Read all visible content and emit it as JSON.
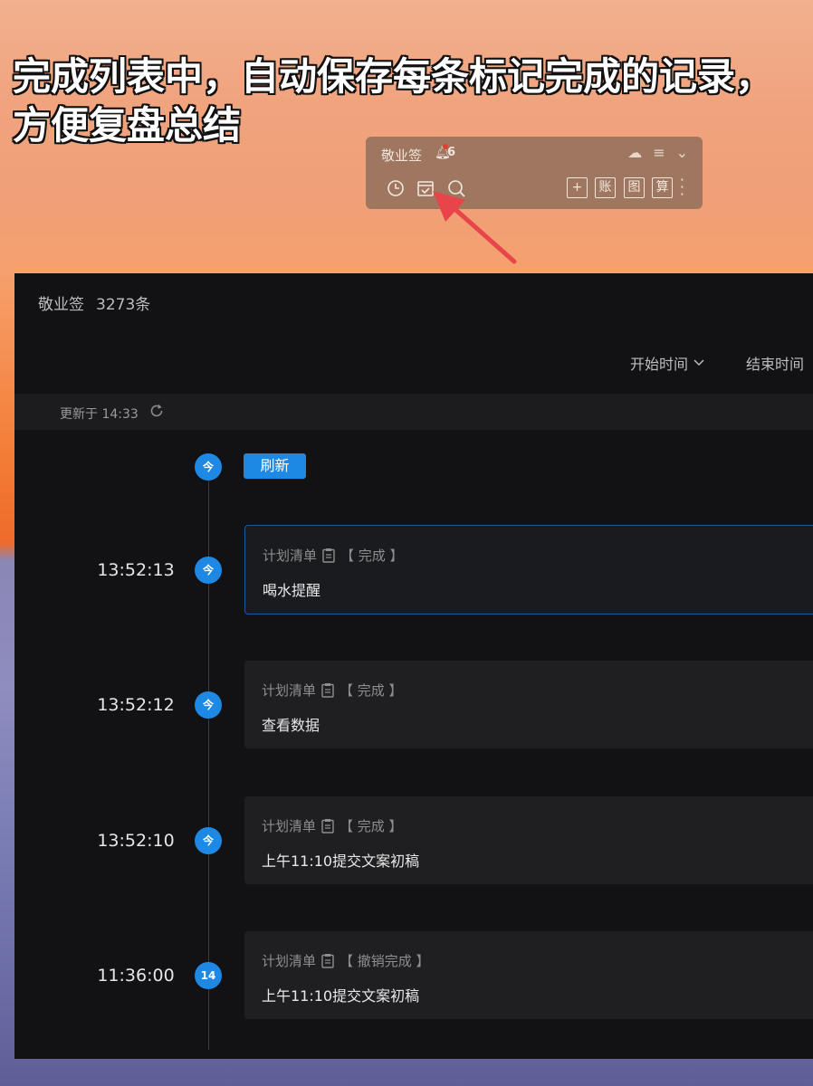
{
  "caption": {
    "line1": "完成列表中，自动保存每条标记完成的记录，",
    "line2": "方便复盘总结"
  },
  "widget": {
    "title": "敬业签",
    "reminder_count": "6",
    "buttons": [
      "+",
      "账",
      "图",
      "算"
    ],
    "icons": [
      "clock-icon",
      "done-list-icon",
      "search-icon",
      "cloud-icon",
      "menu-icon",
      "chevron-down-icon"
    ]
  },
  "window": {
    "title": "敬业签",
    "count": "3273条",
    "filter_start": "开始时间",
    "filter_end": "结束时间",
    "updated_text": "更新于 14:33",
    "refresh_button": "刷新",
    "today_marker": "今",
    "records": [
      {
        "time": "13:52:13",
        "node": "今",
        "list": "计划清单",
        "status": "【 完成 】",
        "content": "喝水提醒"
      },
      {
        "time": "13:52:12",
        "node": "今",
        "list": "计划清单",
        "status": "【 完成 】",
        "content": "查看数据"
      },
      {
        "time": "13:52:10",
        "node": "今",
        "list": "计划清单",
        "status": "【 完成 】",
        "content": "上午11:10提交文案初稿"
      },
      {
        "time": "11:36:00",
        "node": "14",
        "list": "计划清单",
        "status": "【 撤销完成 】",
        "content": "上午11:10提交文案初稿"
      }
    ]
  },
  "colors": {
    "accent": "#1e88e5",
    "window_bg": "#121214",
    "card_bg": "#1f1f21",
    "arrow": "#e8454b"
  }
}
